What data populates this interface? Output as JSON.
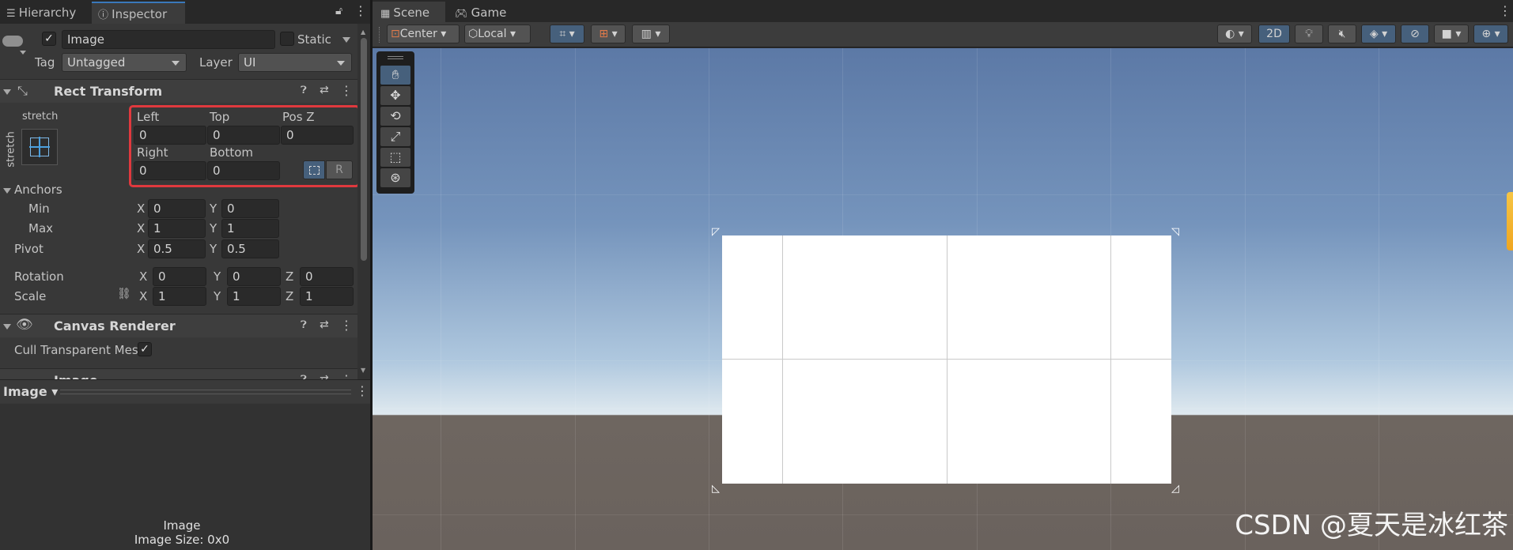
{
  "left_tabs": {
    "hierarchy": "Hierarchy",
    "inspector": "Inspector"
  },
  "object": {
    "name": "Image",
    "static_label": "Static",
    "tag_label": "Tag",
    "tag_value": "Untagged",
    "layer_label": "Layer",
    "layer_value": "UI"
  },
  "rect_transform": {
    "title": "Rect Transform",
    "anchor_preset_top": "stretch",
    "anchor_preset_side": "stretch",
    "fields": {
      "left_label": "Left",
      "top_label": "Top",
      "posz_label": "Pos Z",
      "left": "0",
      "top": "0",
      "posz": "0",
      "right_label": "Right",
      "bottom_label": "Bottom",
      "right": "0",
      "bottom": "0"
    },
    "r_button": "R",
    "anchors_label": "Anchors",
    "min_label": "Min",
    "max_label": "Max",
    "min_x": "0",
    "min_y": "0",
    "max_x": "1",
    "max_y": "1",
    "pivot_label": "Pivot",
    "pivot_x": "0.5",
    "pivot_y": "0.5",
    "rotation_label": "Rotation",
    "rot_x": "0",
    "rot_y": "0",
    "rot_z": "0",
    "scale_label": "Scale",
    "scale_x": "1",
    "scale_y": "1",
    "scale_z": "1",
    "x": "X",
    "y": "Y",
    "z": "Z"
  },
  "canvas_renderer": {
    "title": "Canvas Renderer",
    "cull_label": "Cull Transparent Mesl",
    "cull_checked": "✓"
  },
  "image_component": {
    "title": "Image"
  },
  "preview": {
    "dropdown": "Image",
    "name": "Image",
    "size": "Image Size: 0x0"
  },
  "scene_tabs": {
    "scene": "Scene",
    "game": "Game"
  },
  "scene_toolbar": {
    "pivot": "Center",
    "space": "Local",
    "mode_2d": "2D"
  },
  "watermark": "CSDN @夏天是冰红茶",
  "colors": {
    "highlight": "#e0393e",
    "accent_blue": "#46607c",
    "tab_accent": "#3a79bb"
  }
}
